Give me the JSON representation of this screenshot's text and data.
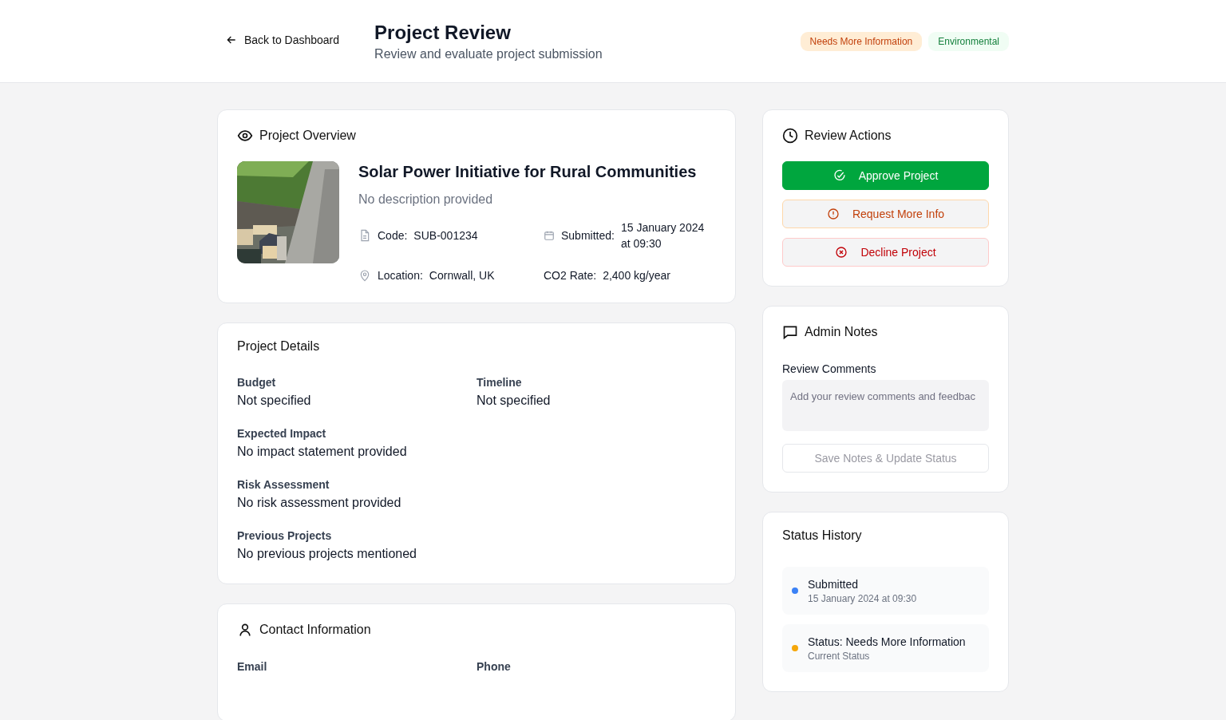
{
  "header": {
    "back_link": "Back to Dashboard",
    "title": "Project Review",
    "subtitle": "Review and evaluate project submission",
    "badges": [
      {
        "label": "Needs More Information",
        "kind": "status"
      },
      {
        "label": "Environmental",
        "kind": "category"
      }
    ]
  },
  "overview": {
    "heading": "Project Overview",
    "title": "Solar Power Initiative for Rural Communities",
    "description": "No description provided",
    "meta": [
      {
        "kind": "code",
        "label": "Code:",
        "value": "SUB-001234"
      },
      {
        "kind": "submitted",
        "label": "Submitted:",
        "value": "15 January 2024 at 09:30"
      },
      {
        "kind": "location",
        "label": "Location:",
        "value": "Cornwall, UK"
      },
      {
        "kind": "co2",
        "label": "CO2 Rate:",
        "value": "2,400 kg/year"
      }
    ]
  },
  "details": {
    "heading": "Project Details",
    "rows": [
      [
        {
          "label": "Budget",
          "value": "Not specified"
        },
        {
          "label": "Timeline",
          "value": "Not specified"
        }
      ],
      [
        {
          "label": "Expected Impact",
          "value": "No impact statement provided"
        }
      ],
      [
        {
          "label": "Risk Assessment",
          "value": "No risk assessment provided"
        }
      ],
      [
        {
          "label": "Previous Projects",
          "value": "No previous projects mentioned"
        }
      ]
    ]
  },
  "contact": {
    "heading": "Contact Information",
    "rows": [
      [
        {
          "label": "Email"
        },
        {
          "label": "Phone"
        }
      ]
    ]
  },
  "review_actions": {
    "heading": "Review Actions",
    "buttons": [
      {
        "label": "Approve Project",
        "kind": "approve"
      },
      {
        "label": "Request More Info",
        "kind": "request"
      },
      {
        "label": "Decline Project",
        "kind": "decline"
      }
    ]
  },
  "admin_notes": {
    "heading": "Admin Notes",
    "field_label": "Review Comments",
    "placeholder": "Add your review comments and feedbac",
    "button": {
      "label": "Save Notes & Update Status",
      "disabled": true
    }
  },
  "status_history": {
    "heading": "Status History",
    "entries": [
      {
        "title": "Submitted",
        "subtitle": "15 January 2024 at 09:30",
        "color": "#3b82f6"
      },
      {
        "title": "Status: Needs More Information",
        "subtitle": "Current Status",
        "color": "#f5a70b"
      }
    ]
  }
}
